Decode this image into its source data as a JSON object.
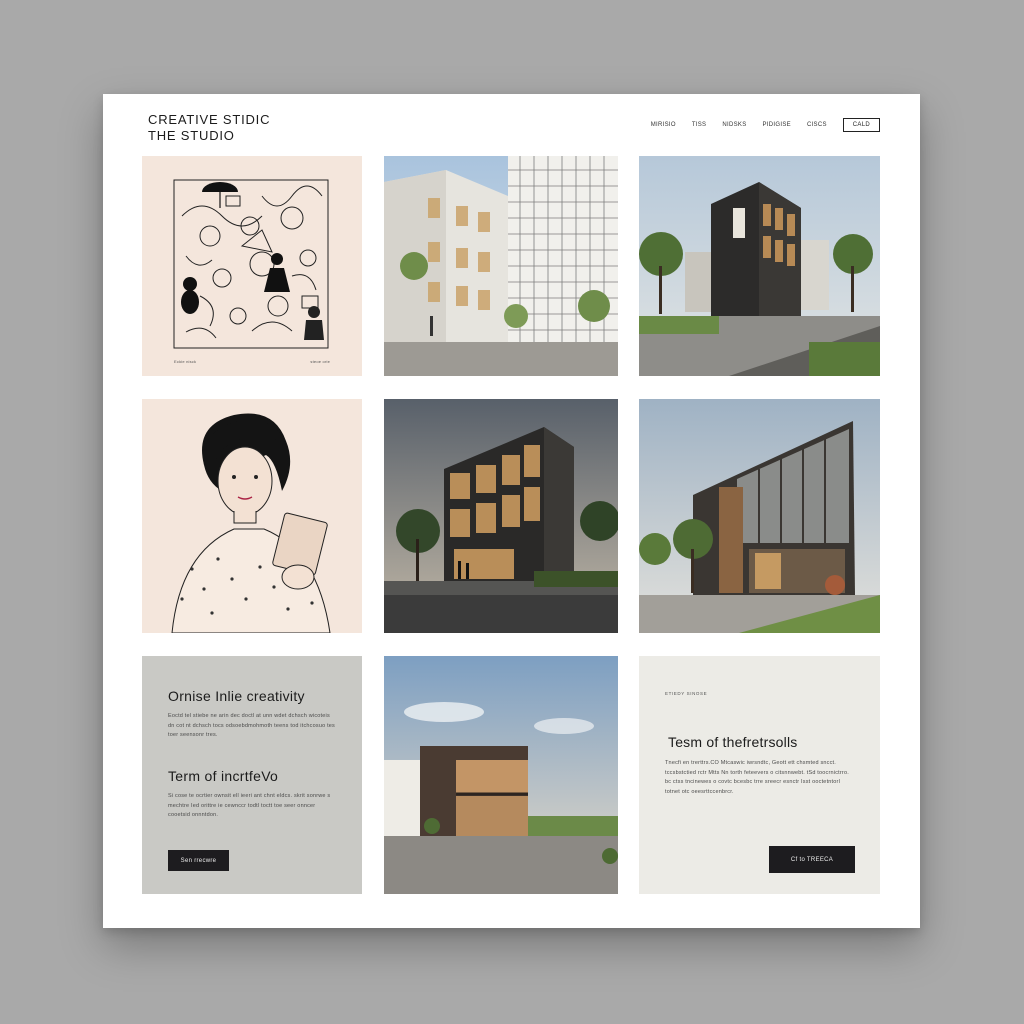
{
  "brand": {
    "line1": "CREATIVE STIDIC",
    "line2": "THE STUDIO"
  },
  "nav": {
    "items": [
      "MIRISIO",
      "TISS",
      "NIDSKS",
      "PIDIGISE",
      "CISCS"
    ],
    "cta": "CALD"
  },
  "tiles": {
    "illustration_top": {
      "caption_left": "Eckie nisck",
      "caption_right": "steoe orie"
    },
    "text_left": {
      "heading1": "Ornise Inlie creativity",
      "para1": "Eoctd tel stiebe ne arin dec doctl at unn wdet dchsch wicoteis dn cot nt dchsch tocs odsoebdmohmoth teens tod itchcosuo tes toer seensonr tres.",
      "heading2": "Term of incrtfeVo",
      "para2": "Si cose te ocrtier ownsit ell ieeri ant chnt eldcs. skrit sonrwe s mechtre Ied orittre ie cewnccr todtl toctt toe seer onncer cooetsid onnntdon.",
      "button": "Sen rrecwre"
    },
    "text_right": {
      "eyebrow": "ETIEDY SINOSE",
      "heading": "Tesm of thefretrsolls",
      "para": "Tnecfi en trerttrs.CO Mtcaswic iwrsndtc, Geott ett chsmted sncct. tccsbstctied rctr Mtts Nn torth feteevers o citsnnwebt. tSd toocrnictrro. bc ctss tncinewes o covtc bcesbc trre sreecr esnctr Isst ooctetntorl totnet otc oeesrttccenbrcr.",
      "button": "Cf to TREECA"
    }
  },
  "colors": {
    "background": "#a9a9a9",
    "page": "#ffffff",
    "illustration_bg": "#f4e6dc",
    "text_panel_left": "#c9c9c5",
    "text_panel_right": "#ecebe6",
    "button": "#1d1c1f"
  }
}
